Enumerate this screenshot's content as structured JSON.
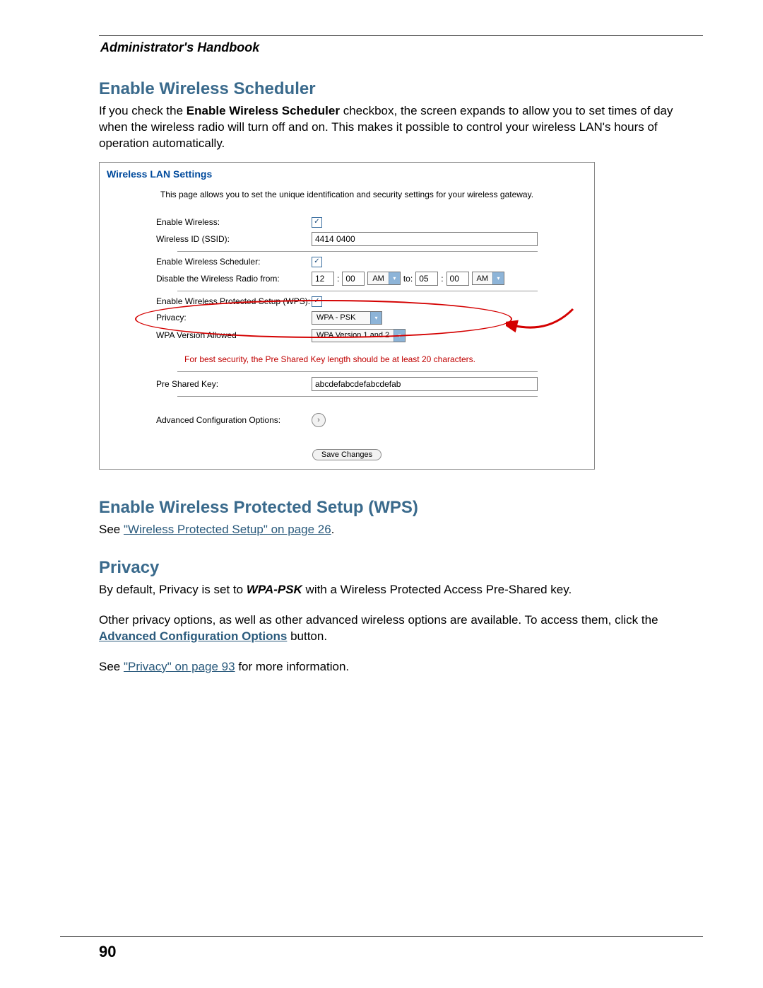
{
  "header": {
    "title": "Administrator's Handbook"
  },
  "section1": {
    "heading": "Enable Wireless Scheduler",
    "para_pre": "If you check the ",
    "para_bold": "Enable Wireless Scheduler",
    "para_post": " checkbox, the screen expands to allow you to set times of day when the wireless radio will turn off and on. This makes it possible to control your wireless LAN's hours of operation automatically."
  },
  "panel": {
    "title": "Wireless LAN Settings",
    "desc": "This page allows you to set the unique identification and security settings for your wireless gateway.",
    "labels": {
      "enable_wireless": "Enable Wireless:",
      "ssid": "Wireless ID (SSID):",
      "enable_scheduler": "Enable Wireless Scheduler:",
      "disable_radio": "Disable the Wireless Radio from:",
      "enable_wps": "Enable Wireless Protected Setup (WPS):",
      "privacy": "Privacy:",
      "wpa_version": "WPA Version Allowed",
      "psk": "Pre Shared Key:",
      "adv": "Advanced Configuration Options:"
    },
    "values": {
      "ssid": "4414 0400",
      "time_h1": "12",
      "time_m1": "00",
      "ampm1": "AM",
      "to": "to:",
      "time_h2": "05",
      "time_m2": "00",
      "ampm2": "AM",
      "privacy": "WPA - PSK",
      "wpa_version": "WPA Version 1 and 2",
      "psk": "abcdefabcdefabcdefab"
    },
    "warn": "For best security, the Pre Shared Key length should be at least 20 characters.",
    "save": "Save Changes",
    "colon": ":",
    "arrow_glyph": "›",
    "dd_glyph": "▾",
    "check_glyph": "✓"
  },
  "section2": {
    "heading": "Enable Wireless Protected Setup (WPS)",
    "text_pre": "See ",
    "link": "\"Wireless Protected Setup\" on page 26",
    "text_post": "."
  },
  "section3": {
    "heading": "Privacy",
    "p1_pre": "By default, Privacy is set to ",
    "p1_bold": "WPA-PSK",
    "p1_post": " with a Wireless Protected Access Pre-Shared key.",
    "p2_pre": "Other privacy options, as well as other advanced wireless options are available. To access them, click the ",
    "p2_link": "Advanced Configuration Options",
    "p2_post": " button.",
    "p3_pre": "See ",
    "p3_link": "\"Privacy\" on page 93",
    "p3_post": " for more information."
  },
  "footer": {
    "pageno": "90"
  }
}
